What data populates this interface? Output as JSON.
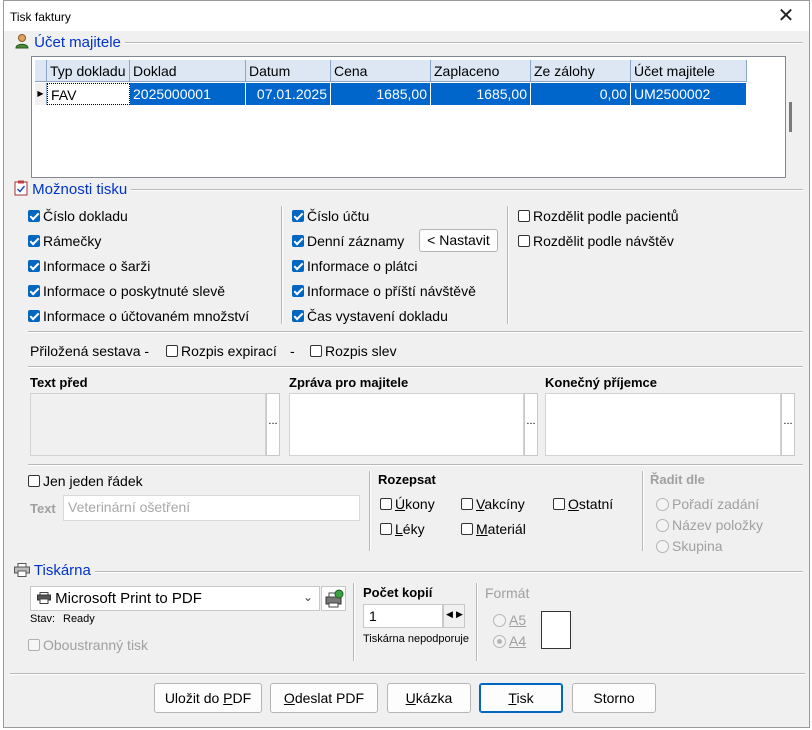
{
  "window": {
    "title": "Tisk faktury",
    "close": "✕"
  },
  "owner_account": {
    "section_title": "Účet majitele",
    "columns": [
      "Typ dokladu",
      "Doklad",
      "Datum",
      "Cena",
      "Zaplaceno",
      "Ze zálohy",
      "Účet majitele"
    ],
    "rows": [
      [
        "FAV",
        "2025000001",
        "07.01.2025",
        "1685,00",
        "1685,00",
        "0,00",
        "UM2500002"
      ]
    ]
  },
  "print_options": {
    "section_title": "Možnosti tisku",
    "col1": [
      {
        "label": "Číslo dokladu",
        "checked": true
      },
      {
        "label": "Rámečky",
        "checked": true
      },
      {
        "label": "Informace o šarži",
        "checked": true
      },
      {
        "label": "Informace o poskytnuté slevě",
        "checked": true
      },
      {
        "label": "Informace o účtovaném množství",
        "checked": true
      }
    ],
    "col2": [
      {
        "label": "Číslo účtu",
        "checked": true
      },
      {
        "label": "Denní záznamy",
        "checked": true
      },
      {
        "label": "Informace o plátci",
        "checked": true
      },
      {
        "label": "Informace o příští návštěvě",
        "checked": true
      },
      {
        "label": "Čas vystavení dokladu",
        "checked": true
      }
    ],
    "set_button": "< Nastavit",
    "col3": [
      {
        "label": "Rozdělit podle pacientů",
        "checked": false
      },
      {
        "label": "Rozdělit podle návštěv",
        "checked": false
      }
    ],
    "attached_label": "Přiložená sestava -",
    "attached_expiry": "Rozpis expirací",
    "attached_dash": "-",
    "attached_discounts": "Rozpis slev"
  },
  "texts": {
    "text_before": "Text před",
    "message_owner": "Zpráva pro majitele",
    "final_recipient": "Konečný příjemce",
    "ellipsis": "..."
  },
  "single_line": {
    "label": "Jen jeden řádek",
    "text_label": "Text",
    "text_value": "Veterinární ošetření"
  },
  "breakdown": {
    "title": "Rozepsat",
    "items": [
      {
        "pre": "",
        "ul": "Ú",
        "post": "kony"
      },
      {
        "pre": "",
        "ul": "V",
        "post": "akcíny"
      },
      {
        "pre": "",
        "ul": "O",
        "post": "statní"
      },
      {
        "pre": "",
        "ul": "L",
        "post": "éky"
      },
      {
        "pre": "",
        "ul": "M",
        "post": "ateriál"
      }
    ]
  },
  "sort_by": {
    "title": "Řadit dle",
    "options": [
      "Pořadí zadání",
      "Název položky",
      "Skupina"
    ]
  },
  "printer": {
    "section_title": "Tiskárna",
    "selected": "Microsoft Print to PDF",
    "status_label": "Stav:",
    "status_value": "Ready",
    "duplex": "Oboustranný tisk",
    "copies_label": "Počet kopií",
    "copies_value": "1",
    "unsupported": "Tiskárna nepodporuje",
    "format_label": "Formát",
    "format_a5": "A5",
    "format_a4": "A4"
  },
  "buttons": {
    "save_pdf": {
      "pre": "Uložit do ",
      "ul": "P",
      "post": "DF"
    },
    "send_pdf": {
      "pre": "",
      "ul": "O",
      "post": "deslat PDF"
    },
    "preview": {
      "pre": "",
      "ul": "U",
      "post": "kázka"
    },
    "print": {
      "pre": "",
      "ul": "T",
      "post": "isk"
    },
    "cancel": "Storno"
  }
}
